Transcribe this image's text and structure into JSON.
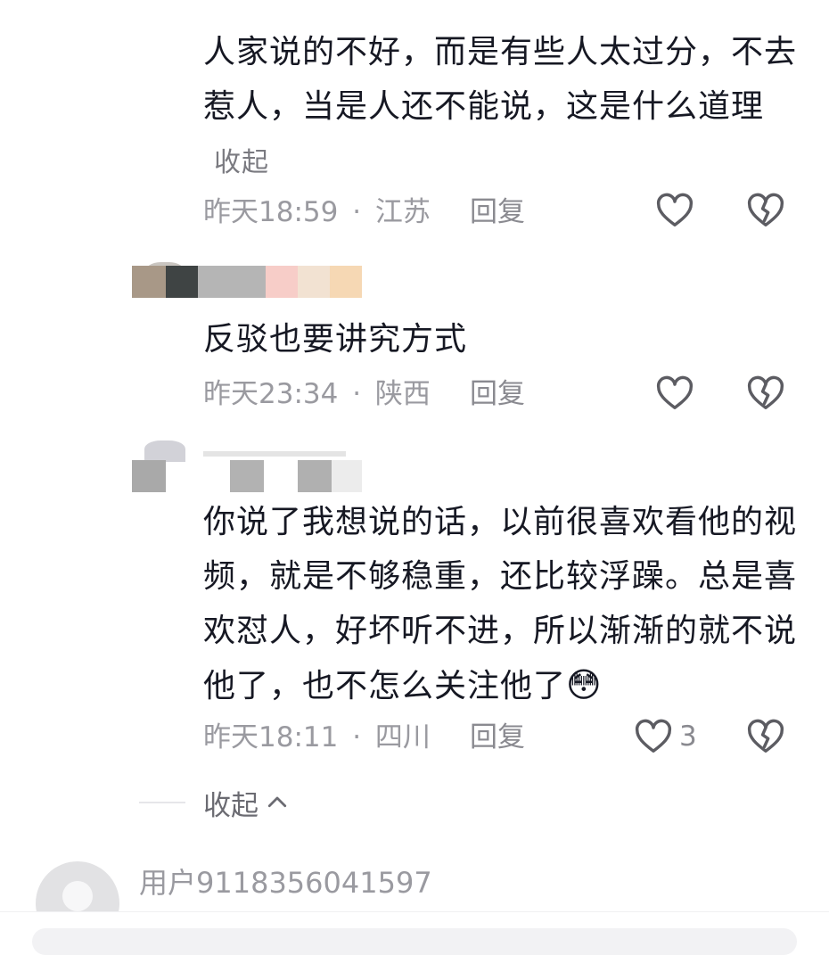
{
  "comments": [
    {
      "text": "人家说的不好，而是有些人太过分，不去惹人，当是人还不能说，这是什么道理",
      "collapse_label": "收起",
      "time": "昨天18:59",
      "separator": "·",
      "location": "江苏",
      "reply_label": "回复"
    },
    {
      "text": "反驳也要讲究方式",
      "time": "昨天23:34",
      "separator": "·",
      "location": "陕西",
      "reply_label": "回复"
    },
    {
      "text": "你说了我想说的话，以前很喜欢看他的视频，就是不够稳重，还比较浮躁。总是喜欢怼人，好坏听不进，所以渐渐的就不说他了，也不怎么关注他了",
      "emoji": "😳",
      "time": "昨天18:11",
      "separator": "·",
      "location": "四川",
      "reply_label": "回复",
      "like_count": "3"
    }
  ],
  "thread_collapse_label": "收起",
  "next_user": {
    "name": "用户9118356041597"
  },
  "icons": {
    "like": "heart-outline-icon",
    "dislike": "broken-heart-icon",
    "collapse": "chevron-up-icon"
  },
  "colors": {
    "text": "#161823",
    "meta": "#9a9aa0",
    "icon": "#5c5c62"
  }
}
